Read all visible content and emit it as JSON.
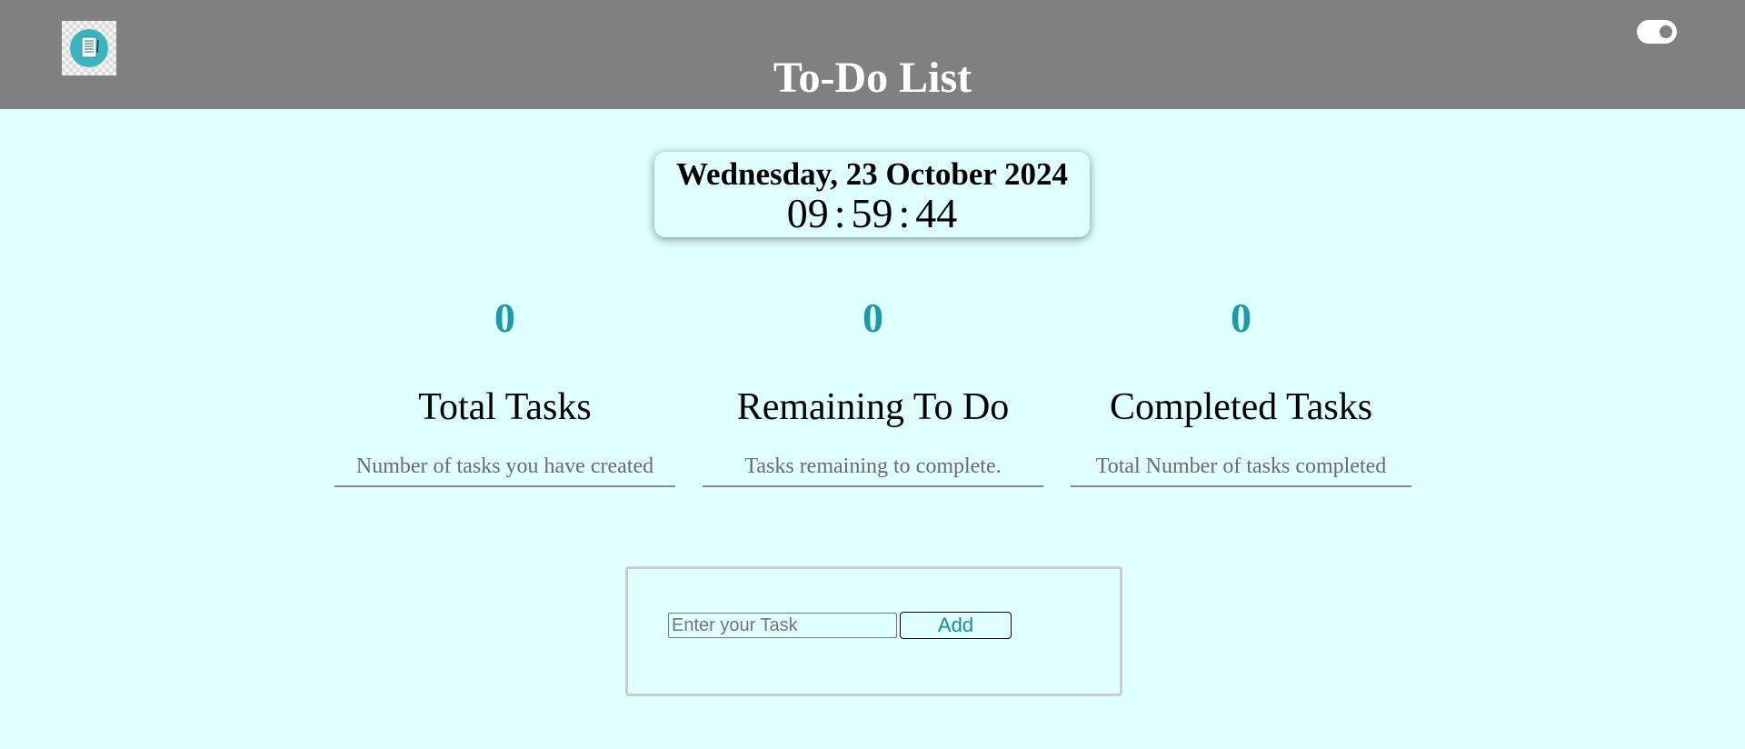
{
  "header": {
    "title": "To-Do List",
    "logo_icon": "notepad-icon",
    "theme_toggle_icon": "toggle-switch-icon"
  },
  "clock": {
    "date": "Wednesday, 23 October 2024",
    "hours": "09",
    "minutes": "59",
    "seconds": "44",
    "separator": ":"
  },
  "stats": [
    {
      "value": "0",
      "label": "Total Tasks",
      "description": "Number of tasks you have created"
    },
    {
      "value": "0",
      "label": "Remaining To Do",
      "description": "Tasks remaining to complete."
    },
    {
      "value": "0",
      "label": "Completed Tasks",
      "description": "Total Number of tasks completed"
    }
  ],
  "task_form": {
    "input_value": "",
    "input_placeholder": "Enter your Task",
    "add_label": "Add"
  },
  "colors": {
    "header_bg": "#808080",
    "page_bg": "#e0ffff",
    "accent": "#1a9ba6"
  }
}
